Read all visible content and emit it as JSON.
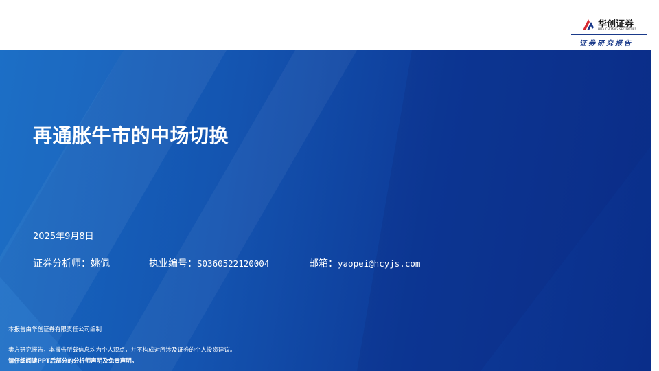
{
  "header": {
    "logo_cn": "华创证券",
    "logo_en": "HUA CHUANG SECURITIES",
    "tagline": "证券研究报告"
  },
  "report": {
    "title": "再通胀牛市的中场切换",
    "date": "2025年9月8日",
    "analyst_label": "证券分析师：",
    "analyst_name": "姚佩",
    "license_label": "执业编号：",
    "license_no": "S0360522120004",
    "email_label": "邮箱：",
    "email": "yaopei@hcyjs.com"
  },
  "footer": {
    "line1": "本报告由华创证券有限责任公司编制",
    "line2": "卖方研究报告，本报告所载信息均为个人观点，并不构成对所涉及证券的个人投资建议。",
    "line3": "请仔细阅读PPT后部分的分析师声明及免责声明。"
  },
  "colors": {
    "banner_light": "#1769c2",
    "banner_dark": "#0a2e8a",
    "logo_red": "#d7282f",
    "logo_blue": "#1a3a8a"
  }
}
